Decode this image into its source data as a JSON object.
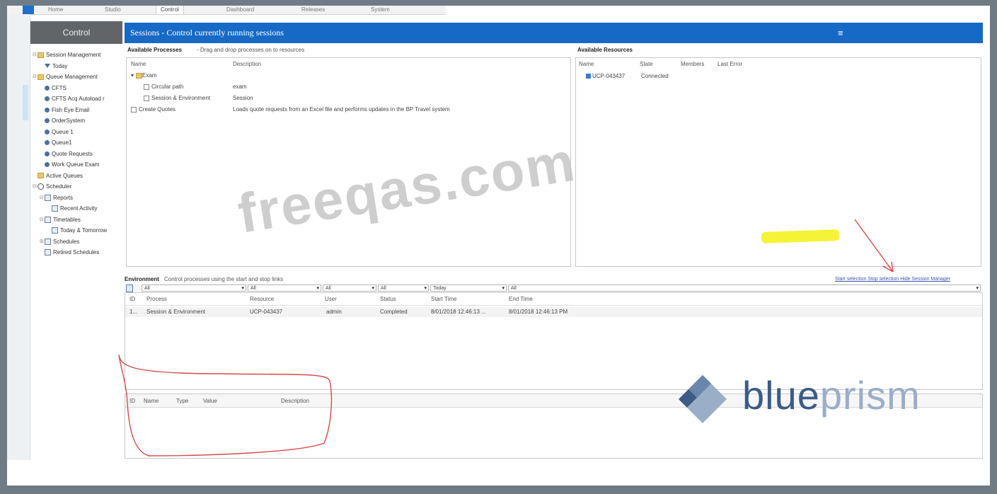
{
  "nav": {
    "tabs": [
      "Home",
      "Studio",
      "Control",
      "Dashboard",
      "Releases",
      "System"
    ],
    "active_tab": "Control"
  },
  "sidebar": {
    "header": "Control",
    "items": [
      {
        "label": "Session Management",
        "icon": "session-management-icon",
        "level": 0,
        "expand": "⊟"
      },
      {
        "label": "Today",
        "icon": "filter-icon",
        "level": 1,
        "expand": ""
      },
      {
        "label": "Queue Management",
        "icon": "queue-management-icon",
        "level": 0,
        "expand": "⊟"
      },
      {
        "label": "CFTS",
        "icon": "queue-icon",
        "level": 1,
        "expand": ""
      },
      {
        "label": "CFTS Acq Autoload r",
        "icon": "queue-icon",
        "level": 1,
        "expand": ""
      },
      {
        "label": "Fish Eye Email",
        "icon": "queue-icon",
        "level": 1,
        "expand": ""
      },
      {
        "label": "OrderSystem",
        "icon": "queue-icon",
        "level": 1,
        "expand": ""
      },
      {
        "label": "Queue 1",
        "icon": "queue-icon",
        "level": 1,
        "expand": ""
      },
      {
        "label": "Queue1",
        "icon": "queue-icon",
        "level": 1,
        "expand": ""
      },
      {
        "label": "Quote Requests",
        "icon": "queue-icon",
        "level": 1,
        "expand": ""
      },
      {
        "label": "Work Queue Exam",
        "icon": "queue-icon",
        "level": 1,
        "expand": ""
      },
      {
        "label": "Active Queues",
        "icon": "active-queues-icon",
        "level": 0,
        "expand": ""
      },
      {
        "label": "Scheduler",
        "icon": "scheduler-icon",
        "level": 0,
        "expand": "⊟"
      },
      {
        "label": "Reports",
        "icon": "reports-icon",
        "level": 1,
        "expand": "⊟"
      },
      {
        "label": "Recent Activity",
        "icon": "report-icon",
        "level": 2,
        "expand": ""
      },
      {
        "label": "Timetables",
        "icon": "timetables-icon",
        "level": 1,
        "expand": "⊟"
      },
      {
        "label": "Today & Tomorrow",
        "icon": "timetable-icon",
        "level": 2,
        "expand": ""
      },
      {
        "label": "Schedules",
        "icon": "schedules-icon",
        "level": 1,
        "expand": "⊞"
      },
      {
        "label": "Retired Schedules",
        "icon": "retired-schedules-icon",
        "level": 1,
        "expand": ""
      }
    ]
  },
  "titlebar": {
    "title": "Sessions - Control currently running sessions",
    "menu_glyph": "≡"
  },
  "processes": {
    "heading": "Available Processes",
    "subheading": "- Drag and drop processes on to resources",
    "columns": [
      "Name",
      "Description"
    ],
    "rows": [
      {
        "name": "Exam",
        "description": "",
        "indent": 0,
        "kind": "group"
      },
      {
        "name": "Circular path",
        "description": "exam",
        "indent": 1,
        "kind": "process"
      },
      {
        "name": "Session & Environment",
        "description": "Session",
        "indent": 1,
        "kind": "process"
      },
      {
        "name": "Create Quotes",
        "description": "Loads quote requests from an Excel file and performs updates in the BP Travel system",
        "indent": 0,
        "kind": "process"
      }
    ]
  },
  "resources": {
    "heading": "Available Resources",
    "columns": [
      "Name",
      "State",
      "Members",
      "Last Error"
    ],
    "rows": [
      {
        "name": "UCP-043437",
        "state": "Connected",
        "members": "",
        "last_error": ""
      }
    ]
  },
  "environment": {
    "heading": "Environment",
    "subheading": "Control processes using the start and stop links",
    "links": "Start selection  Stop selection  Hide Session Manager",
    "filters": [
      "All",
      "All",
      "All",
      "All",
      "Today",
      "All"
    ],
    "columns": [
      "ID",
      "Process",
      "Resource",
      "User",
      "Status",
      "Start Time",
      "End Time"
    ],
    "rows": [
      {
        "id": "1...",
        "process": "Session & Environment",
        "resource": "UCP-043437",
        "user": "admin",
        "status": "Completed",
        "start": "8/01/2018 12:46:13 ...",
        "end": "8/01/2018 12:46:13 PM"
      }
    ]
  },
  "variables": {
    "columns": [
      "ID",
      "Name",
      "Type",
      "Value",
      "Description"
    ]
  },
  "watermark": "freeqas.com",
  "logo": {
    "part1": "blue",
    "part2": "prism"
  },
  "colors": {
    "accent": "#1769c6",
    "sidebar_header": "#616567",
    "annotation": "#d94a4a",
    "highlight": "#f4f22a"
  }
}
